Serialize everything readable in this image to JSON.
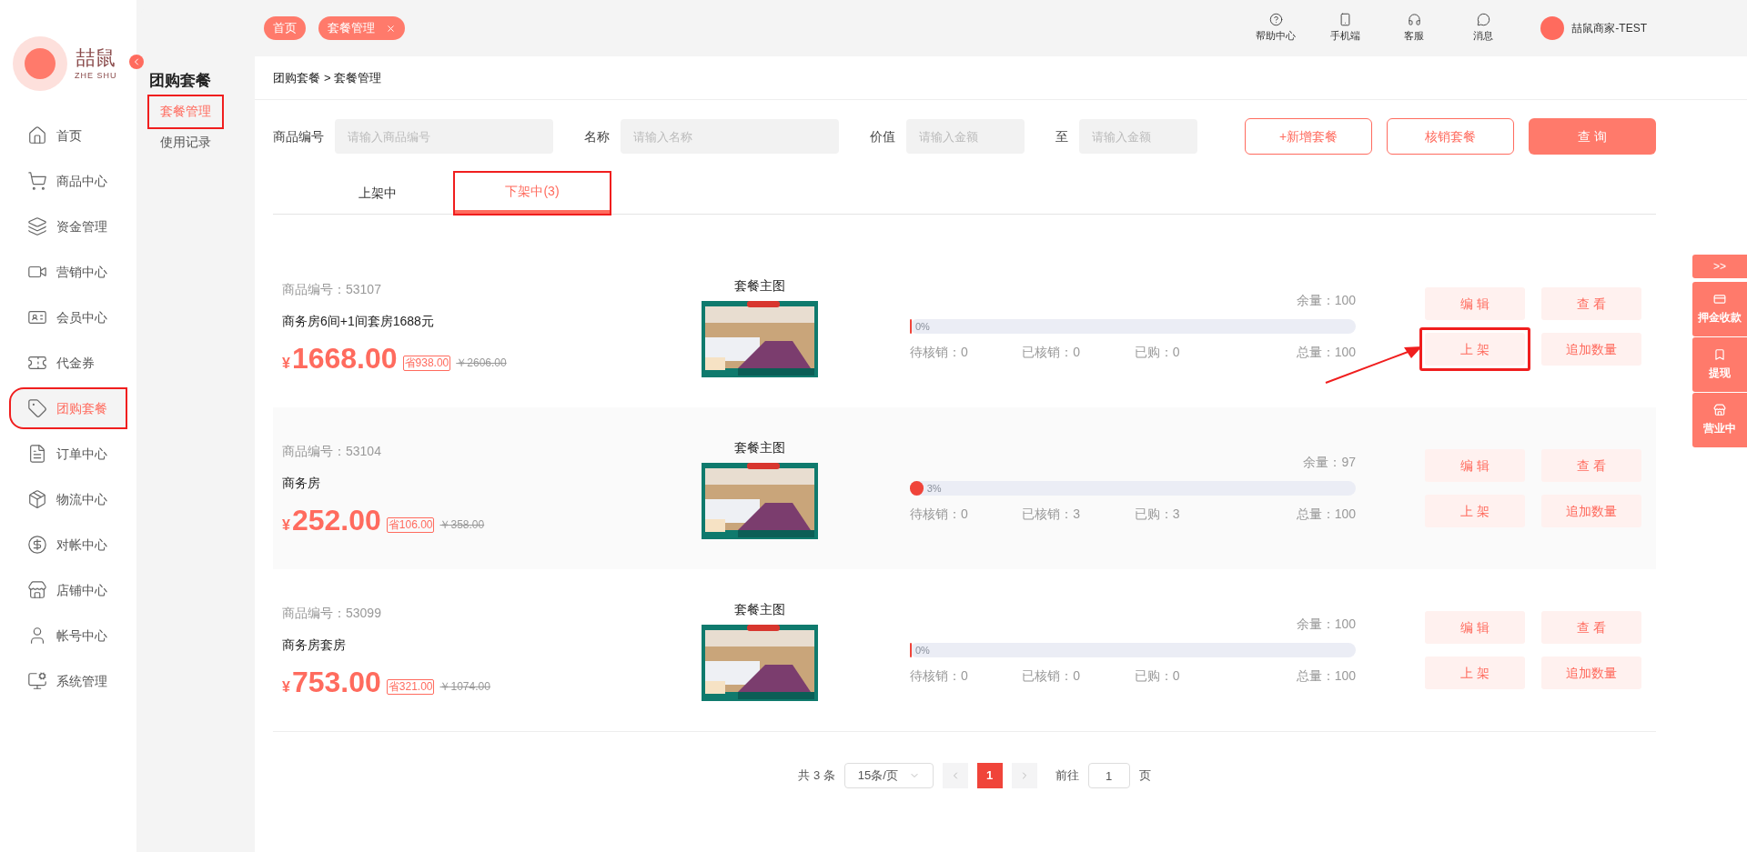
{
  "logo": {
    "mark": "喆鼠",
    "name": "ZHE SHU"
  },
  "nav": [
    {
      "label": "首页",
      "selected": false,
      "annotated": false
    },
    {
      "label": "商品中心",
      "selected": false,
      "annotated": false
    },
    {
      "label": "资金管理",
      "selected": false,
      "annotated": false
    },
    {
      "label": "营销中心",
      "selected": false,
      "annotated": false
    },
    {
      "label": "会员中心",
      "selected": false,
      "annotated": false
    },
    {
      "label": "代金券",
      "selected": false,
      "annotated": false
    },
    {
      "label": "团购套餐",
      "selected": true,
      "annotated": true
    },
    {
      "label": "订单中心",
      "selected": false,
      "annotated": false
    },
    {
      "label": "物流中心",
      "selected": false,
      "annotated": false
    },
    {
      "label": "对帐中心",
      "selected": false,
      "annotated": false
    },
    {
      "label": "店铺中心",
      "selected": false,
      "annotated": false
    },
    {
      "label": "帐号中心",
      "selected": false,
      "annotated": false
    },
    {
      "label": "系统管理",
      "selected": false,
      "annotated": false
    }
  ],
  "subnav": {
    "title": "团购套餐",
    "items": [
      {
        "label": "套餐管理",
        "selected": true,
        "annotated": true
      },
      {
        "label": "使用记录",
        "selected": false,
        "annotated": false
      }
    ]
  },
  "page_tabs": [
    {
      "label": "首页",
      "closable": false
    },
    {
      "label": "套餐管理",
      "closable": true
    }
  ],
  "top_actions": [
    {
      "label": "帮助中心"
    },
    {
      "label": "手机端"
    },
    {
      "label": "客服"
    },
    {
      "label": "消息"
    }
  ],
  "user": {
    "name": "喆鼠商家-TEST"
  },
  "breadcrumb": [
    "团购套餐",
    "> 套餐管理"
  ],
  "filters": [
    {
      "label": "商品编号",
      "placeholder": "请输入商品编号"
    },
    {
      "label": "名称",
      "placeholder": "请输入名称"
    },
    {
      "label": "价值",
      "placeholder": "请输入金额"
    },
    {
      "label": "至",
      "placeholder": "请输入金额"
    }
  ],
  "buttons": [
    {
      "label": "+新增套餐",
      "kind": "outline"
    },
    {
      "label": "核销套餐",
      "kind": "outline"
    },
    {
      "label": "查 询",
      "kind": "solid"
    }
  ],
  "status_tabs": [
    {
      "label": "上架中",
      "selected": false,
      "annotated": false
    },
    {
      "label": "下架中(3)",
      "selected": true,
      "annotated": true
    }
  ],
  "packages": [
    {
      "code": "商品编号：53107",
      "name": "商务房6间+1间套房1688元",
      "currency": "¥",
      "price": "1668.00",
      "saving": "省938.00",
      "original": "￥2606.00",
      "image_label": "套餐主图",
      "remaining": "余量：100",
      "level": 0,
      "percent": "0%",
      "stats": [
        "待核销：0",
        "已核销：0",
        "已购：0",
        "总量：100"
      ],
      "actions": [
        {
          "label": "编 辑",
          "annotated": false
        },
        {
          "label": "查 看",
          "annotated": false
        },
        {
          "label": "上 架",
          "annotated": true
        },
        {
          "label": "追加数量",
          "annotated": false
        }
      ]
    },
    {
      "code": "商品编号：53104",
      "name": "商务房",
      "currency": "¥",
      "price": "252.00",
      "saving": "省106.00",
      "original": "￥358.00",
      "image_label": "套餐主图",
      "remaining": "余量：97",
      "level": 0.03,
      "percent": "3%",
      "stats": [
        "待核销：0",
        "已核销：3",
        "已购：3",
        "总量：100"
      ],
      "actions": [
        {
          "label": "编 辑",
          "annotated": false
        },
        {
          "label": "查 看",
          "annotated": false
        },
        {
          "label": "上 架",
          "annotated": false
        },
        {
          "label": "追加数量",
          "annotated": false
        }
      ]
    },
    {
      "code": "商品编号：53099",
      "name": "商务房套房",
      "currency": "¥",
      "price": "753.00",
      "saving": "省321.00",
      "original": "￥1074.00",
      "image_label": "套餐主图",
      "remaining": "余量：100",
      "level": 0,
      "percent": "0%",
      "stats": [
        "待核销：0",
        "已核销：0",
        "已购：0",
        "总量：100"
      ],
      "actions": [
        {
          "label": "编 辑",
          "annotated": false
        },
        {
          "label": "查 看",
          "annotated": false
        },
        {
          "label": "上 架",
          "annotated": false
        },
        {
          "label": "追加数量",
          "annotated": false
        }
      ]
    }
  ],
  "pagination": {
    "total": "共 3 条",
    "page_size": "15条/页",
    "pages": [
      {
        "label": "1",
        "selected": true
      }
    ],
    "goto_label": "前往",
    "goto_value": "1",
    "goto_suffix": "页"
  },
  "float_panel": {
    "toggle": ">>",
    "items": [
      {
        "label": "押金收款"
      },
      {
        "label": "提现"
      },
      {
        "label": "营业中"
      }
    ]
  }
}
